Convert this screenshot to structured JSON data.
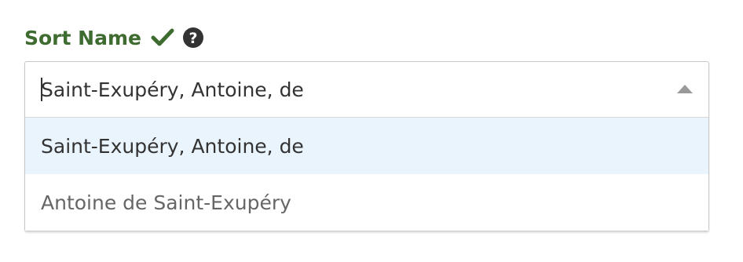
{
  "field": {
    "label": "Sort Name",
    "status_icon": "checkmark-icon",
    "help_icon": "question-circle-icon",
    "input_value": "Saint-Exupéry, Antoine, de",
    "dropdown_open": true,
    "options": [
      {
        "label": "Saint-Exupéry, Antoine, de",
        "highlighted": true
      },
      {
        "label": "Antoine de Saint-Exupéry",
        "highlighted": false
      }
    ]
  },
  "colors": {
    "label": "#3e6b2f",
    "highlight": "#eaf4fd",
    "border": "#c9c9c9"
  }
}
